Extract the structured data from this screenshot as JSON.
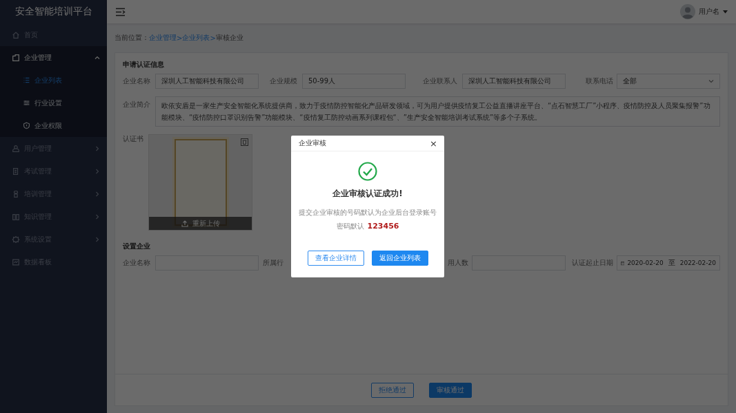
{
  "app_title": "安全智能培训平台",
  "sidebar": {
    "items": [
      {
        "label": "首页",
        "kind": "link",
        "selected": false
      },
      {
        "label": "企业管理",
        "kind": "group",
        "expanded": true,
        "selected": false,
        "children": [
          {
            "label": "企业列表",
            "selected": true
          },
          {
            "label": "行业设置",
            "selected": false
          },
          {
            "label": "企业权限",
            "selected": false
          }
        ]
      },
      {
        "label": "用户管理",
        "kind": "group",
        "expanded": false,
        "selected": false
      },
      {
        "label": "考试管理",
        "kind": "group",
        "expanded": false,
        "selected": false
      },
      {
        "label": "培训管理",
        "kind": "group",
        "expanded": false,
        "selected": false
      },
      {
        "label": "知识管理",
        "kind": "group",
        "expanded": false,
        "selected": false
      },
      {
        "label": "系统设置",
        "kind": "group",
        "expanded": false,
        "selected": false
      },
      {
        "label": "数据看板",
        "kind": "link",
        "selected": false
      }
    ]
  },
  "header": {
    "user_name": "用户名"
  },
  "breadcrumb": {
    "label": "当前位置：",
    "items": [
      {
        "label": "企业管理",
        "kind": "link"
      },
      {
        "label": ">",
        "kind": "separator"
      },
      {
        "label": "企业列表",
        "kind": "link"
      },
      {
        "label": ">",
        "kind": "separator"
      },
      {
        "label": "审核企业",
        "kind": "current"
      }
    ]
  },
  "application": {
    "title": "申请认证信息",
    "fields": [
      {
        "label": "企业名称",
        "kind": "text",
        "value": "深圳人工智能科技有限公司"
      },
      {
        "label": "企业规模",
        "kind": "text",
        "value": "50-99人"
      },
      {
        "label": "企业联系人",
        "kind": "text",
        "value": "深圳人工智能科技有限公司"
      },
      {
        "label": "联系电话",
        "kind": "select",
        "value": "全部"
      }
    ],
    "intro": {
      "label": "企业简介",
      "value": "欧依安盾是一家生产安全智能化系统提供商，致力于疫情防控智能化产品研发领域，可为用户提供疫情复工公益直播讲座平台、“点石智慧工厂”小程序、疫情防控及人员聚集报警”功能模块、“疫情防控口罩识别告警”功能模块、“疫情复工防控动画系列课程包“、”生产安全智能培训考试系统”等多个子系统。"
    },
    "certificate": {
      "label": "认证书",
      "reupload": "重新上传"
    }
  },
  "settings": {
    "title": "设置企业",
    "fields": [
      {
        "label": "企业名称",
        "kind": "text"
      },
      {
        "label": "所属行",
        "kind": "label"
      },
      {
        "label": "用人数",
        "kind": "text"
      },
      {
        "label": "认证起止日期",
        "kind": "date-range",
        "start": "2020-02-20",
        "separator": "至",
        "end": "2022-02-20"
      }
    ]
  },
  "footer_buttons": [
    {
      "label": "拒绝通过",
      "kind": "outline"
    },
    {
      "label": "审核通过",
      "kind": "primary"
    }
  ],
  "dialog": {
    "title": "企业审核",
    "close": "×",
    "heading": "企业审核认证成功!",
    "message": "提交企业审核的号码默认为企业后台登录账号",
    "password_label": "密码默认",
    "password": "123456",
    "buttons": [
      {
        "label": "查看企业详情",
        "kind": "outline"
      },
      {
        "label": "返回企业列表",
        "kind": "primary"
      }
    ]
  }
}
